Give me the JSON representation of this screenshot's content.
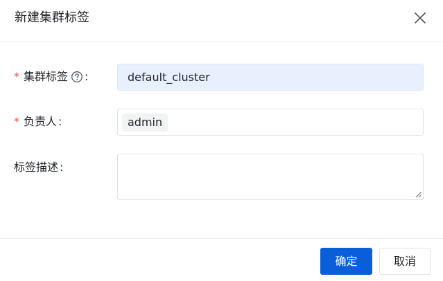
{
  "dialog": {
    "title": "新建集群标签",
    "close_icon": "close-icon"
  },
  "form": {
    "cluster_tag": {
      "required_mark": "*",
      "label": "集群标签",
      "help_icon": "question-circle-icon",
      "colon": ":",
      "value": "default_cluster"
    },
    "owner": {
      "required_mark": "*",
      "label": "负责人",
      "colon": ":",
      "tags": [
        "admin"
      ]
    },
    "description": {
      "label": "标签描述",
      "colon": ":",
      "value": ""
    }
  },
  "footer": {
    "confirm_label": "确定",
    "cancel_label": "取消"
  },
  "colors": {
    "primary": "#0a5ed8",
    "required": "#f54a45",
    "input_filled_bg": "#e8effd"
  }
}
